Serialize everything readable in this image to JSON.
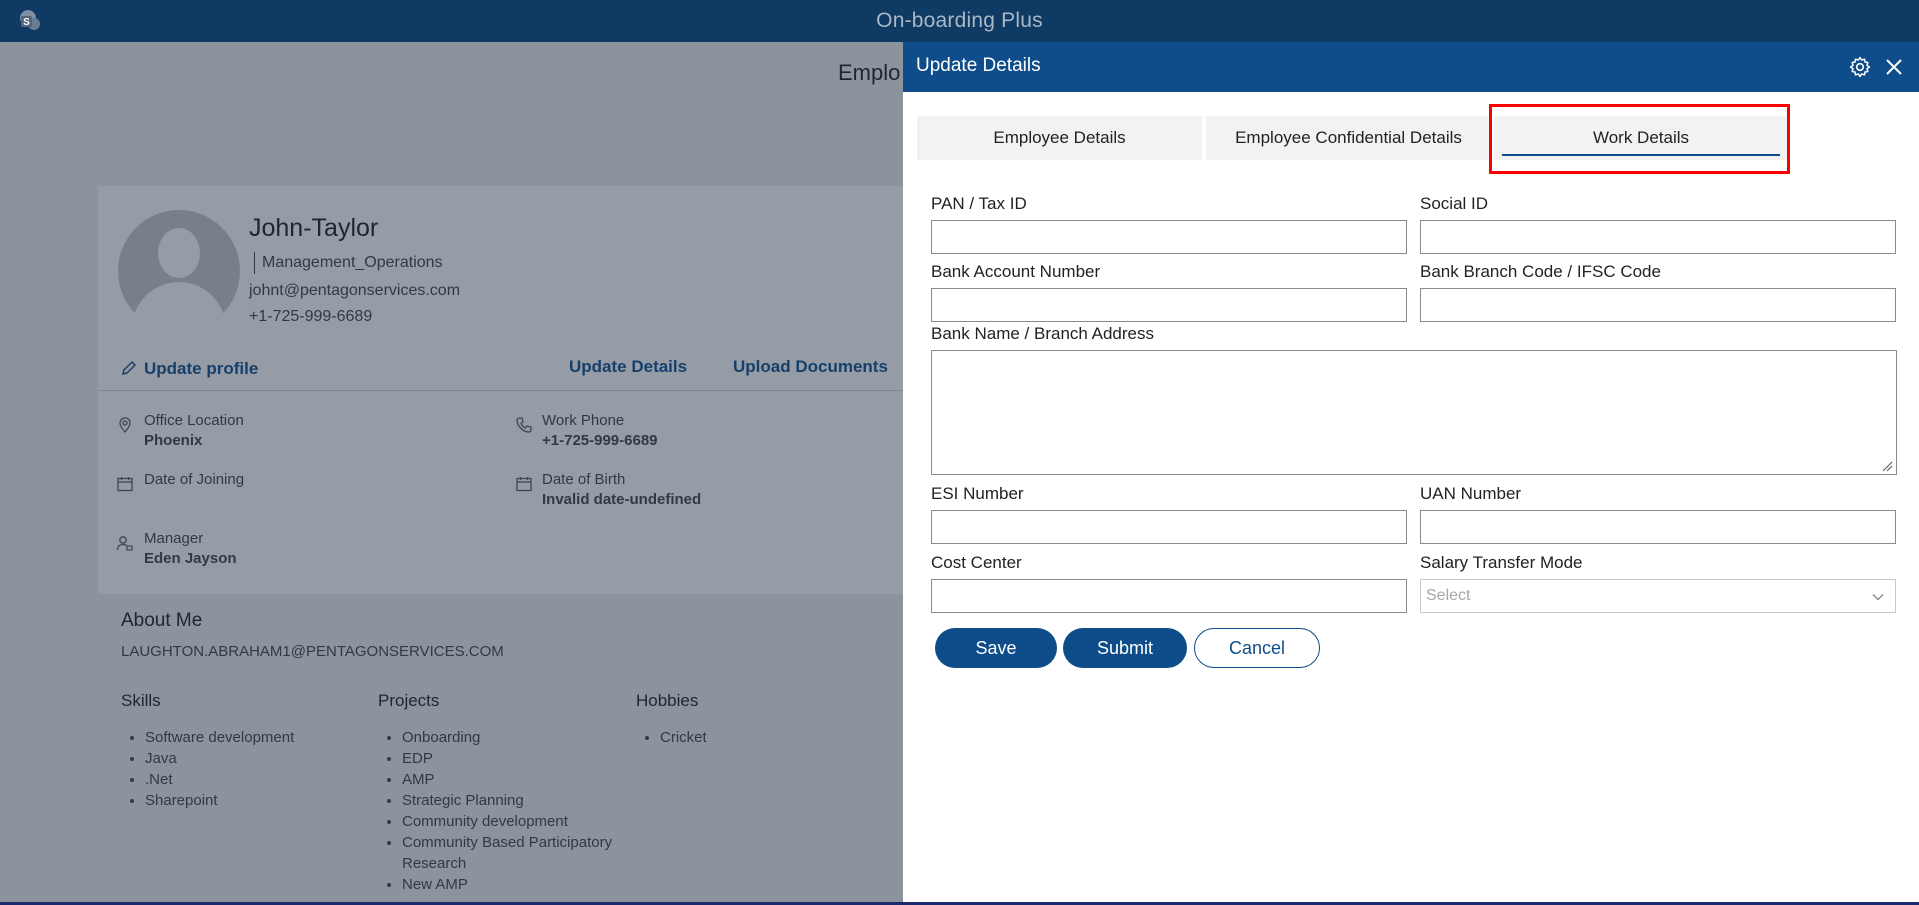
{
  "app": {
    "title": "On-boarding Plus"
  },
  "background": {
    "page_title_fragment": "Emplo",
    "profile": {
      "name": "John-Taylor",
      "department": "Management_Operations",
      "email": "johnt@pentagonservices.com",
      "phone": "+1-725-999-6689"
    },
    "actions": {
      "update_profile": "Update profile",
      "update_details": "Update Details",
      "upload_documents": "Upload Documents"
    },
    "info": {
      "office_location_label": "Office Location",
      "office_location_value": "Phoenix",
      "work_phone_label": "Work Phone",
      "work_phone_value": "+1-725-999-6689",
      "date_of_joining_label": "Date of Joining",
      "date_of_birth_label": "Date of Birth",
      "date_of_birth_value": "Invalid date-undefined",
      "manager_label": "Manager",
      "manager_value": "Eden Jayson"
    },
    "about": {
      "title": "About Me",
      "email": "LAUGHTON.ABRAHAM1@PENTAGONSERVICES.COM",
      "skills_title": "Skills",
      "skills": [
        "Software development",
        "Java",
        ".Net",
        "Sharepoint"
      ],
      "projects_title": "Projects",
      "projects": [
        "Onboarding",
        "EDP",
        "AMP",
        "Strategic Planning",
        "Community development",
        "Community Based Participatory",
        "Research",
        "New AMP"
      ],
      "hobbies_title": "Hobbies",
      "hobbies": [
        "Cricket"
      ]
    }
  },
  "panel": {
    "title": "Update Details",
    "tabs": [
      {
        "label": "Employee Details"
      },
      {
        "label": "Employee Confidential Details"
      },
      {
        "label": "Work Details",
        "active": true
      }
    ],
    "form": {
      "pan_label": "PAN / Tax ID",
      "pan_value": "",
      "social_label": "Social ID",
      "social_value": "",
      "bank_account_label": "Bank Account Number",
      "bank_account_value": "",
      "bank_branch_label": "Bank Branch Code / IFSC Code",
      "bank_branch_value": "",
      "bank_name_label": "Bank Name / Branch Address",
      "bank_name_value": "",
      "esi_label": "ESI Number",
      "esi_value": "",
      "uan_label": "UAN Number",
      "uan_value": "",
      "cost_center_label": "Cost Center",
      "cost_center_value": "",
      "salary_mode_label": "Salary Transfer Mode",
      "salary_mode_value": "Select"
    },
    "buttons": {
      "save": "Save",
      "submit": "Submit",
      "cancel": "Cancel"
    }
  },
  "icons": {
    "app_logo": "sharepoint-logo-icon",
    "settings": "gear-icon",
    "close": "close-icon",
    "edit": "pencil-icon",
    "location": "location-pin-icon",
    "phone": "phone-icon",
    "calendar": "calendar-icon",
    "manager": "user-icon",
    "dropdown": "chevron-down-icon"
  },
  "colors": {
    "topbar": "#0f3a64",
    "panel_header": "#0f4c8a",
    "primary_button": "#0f4c8a",
    "highlight_box": "#ff0000",
    "overlay": "#8b939c"
  }
}
